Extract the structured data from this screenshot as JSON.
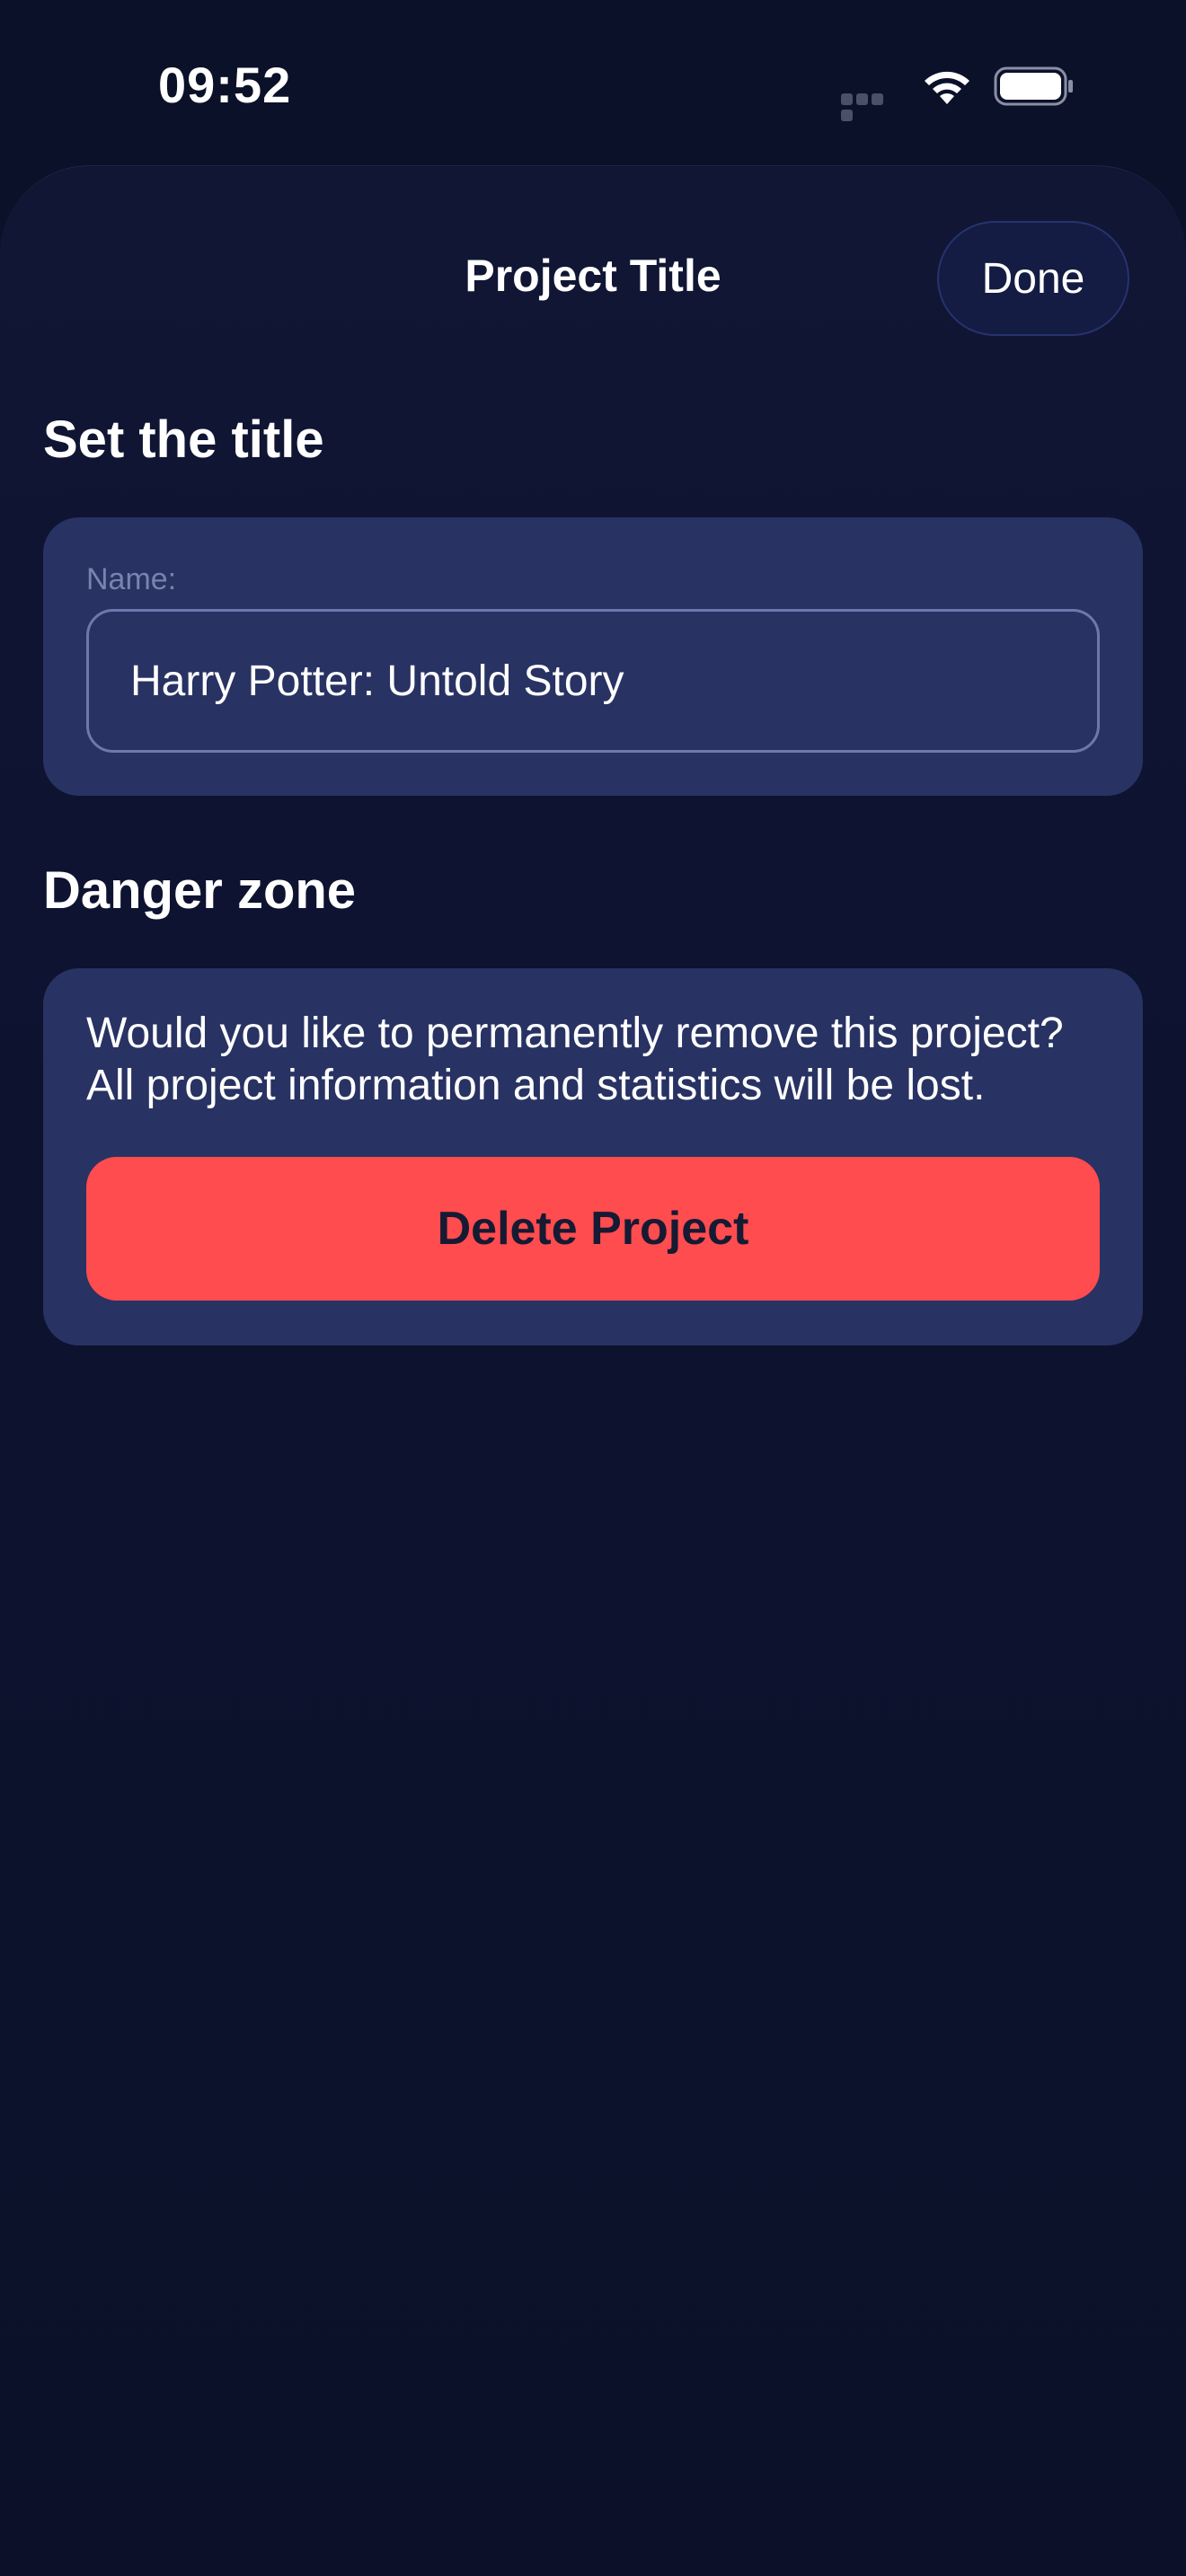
{
  "status_bar": {
    "time": "09:52",
    "icons": [
      "signal-icon",
      "wifi-icon",
      "battery-icon"
    ]
  },
  "header": {
    "title": "Project Title",
    "done_label": "Done"
  },
  "title_section": {
    "heading": "Set the title",
    "name_label": "Name:",
    "name_value": "Harry Potter: Untold Story"
  },
  "danger_section": {
    "heading": "Danger zone",
    "warning_text": "Would you like to permanently remove this project? All project information and statistics will be lost.",
    "delete_label": "Delete Project"
  },
  "colors": {
    "background": "#0b1128",
    "card": "#283263",
    "danger": "#fe4c4f",
    "text": "#ffffff"
  }
}
